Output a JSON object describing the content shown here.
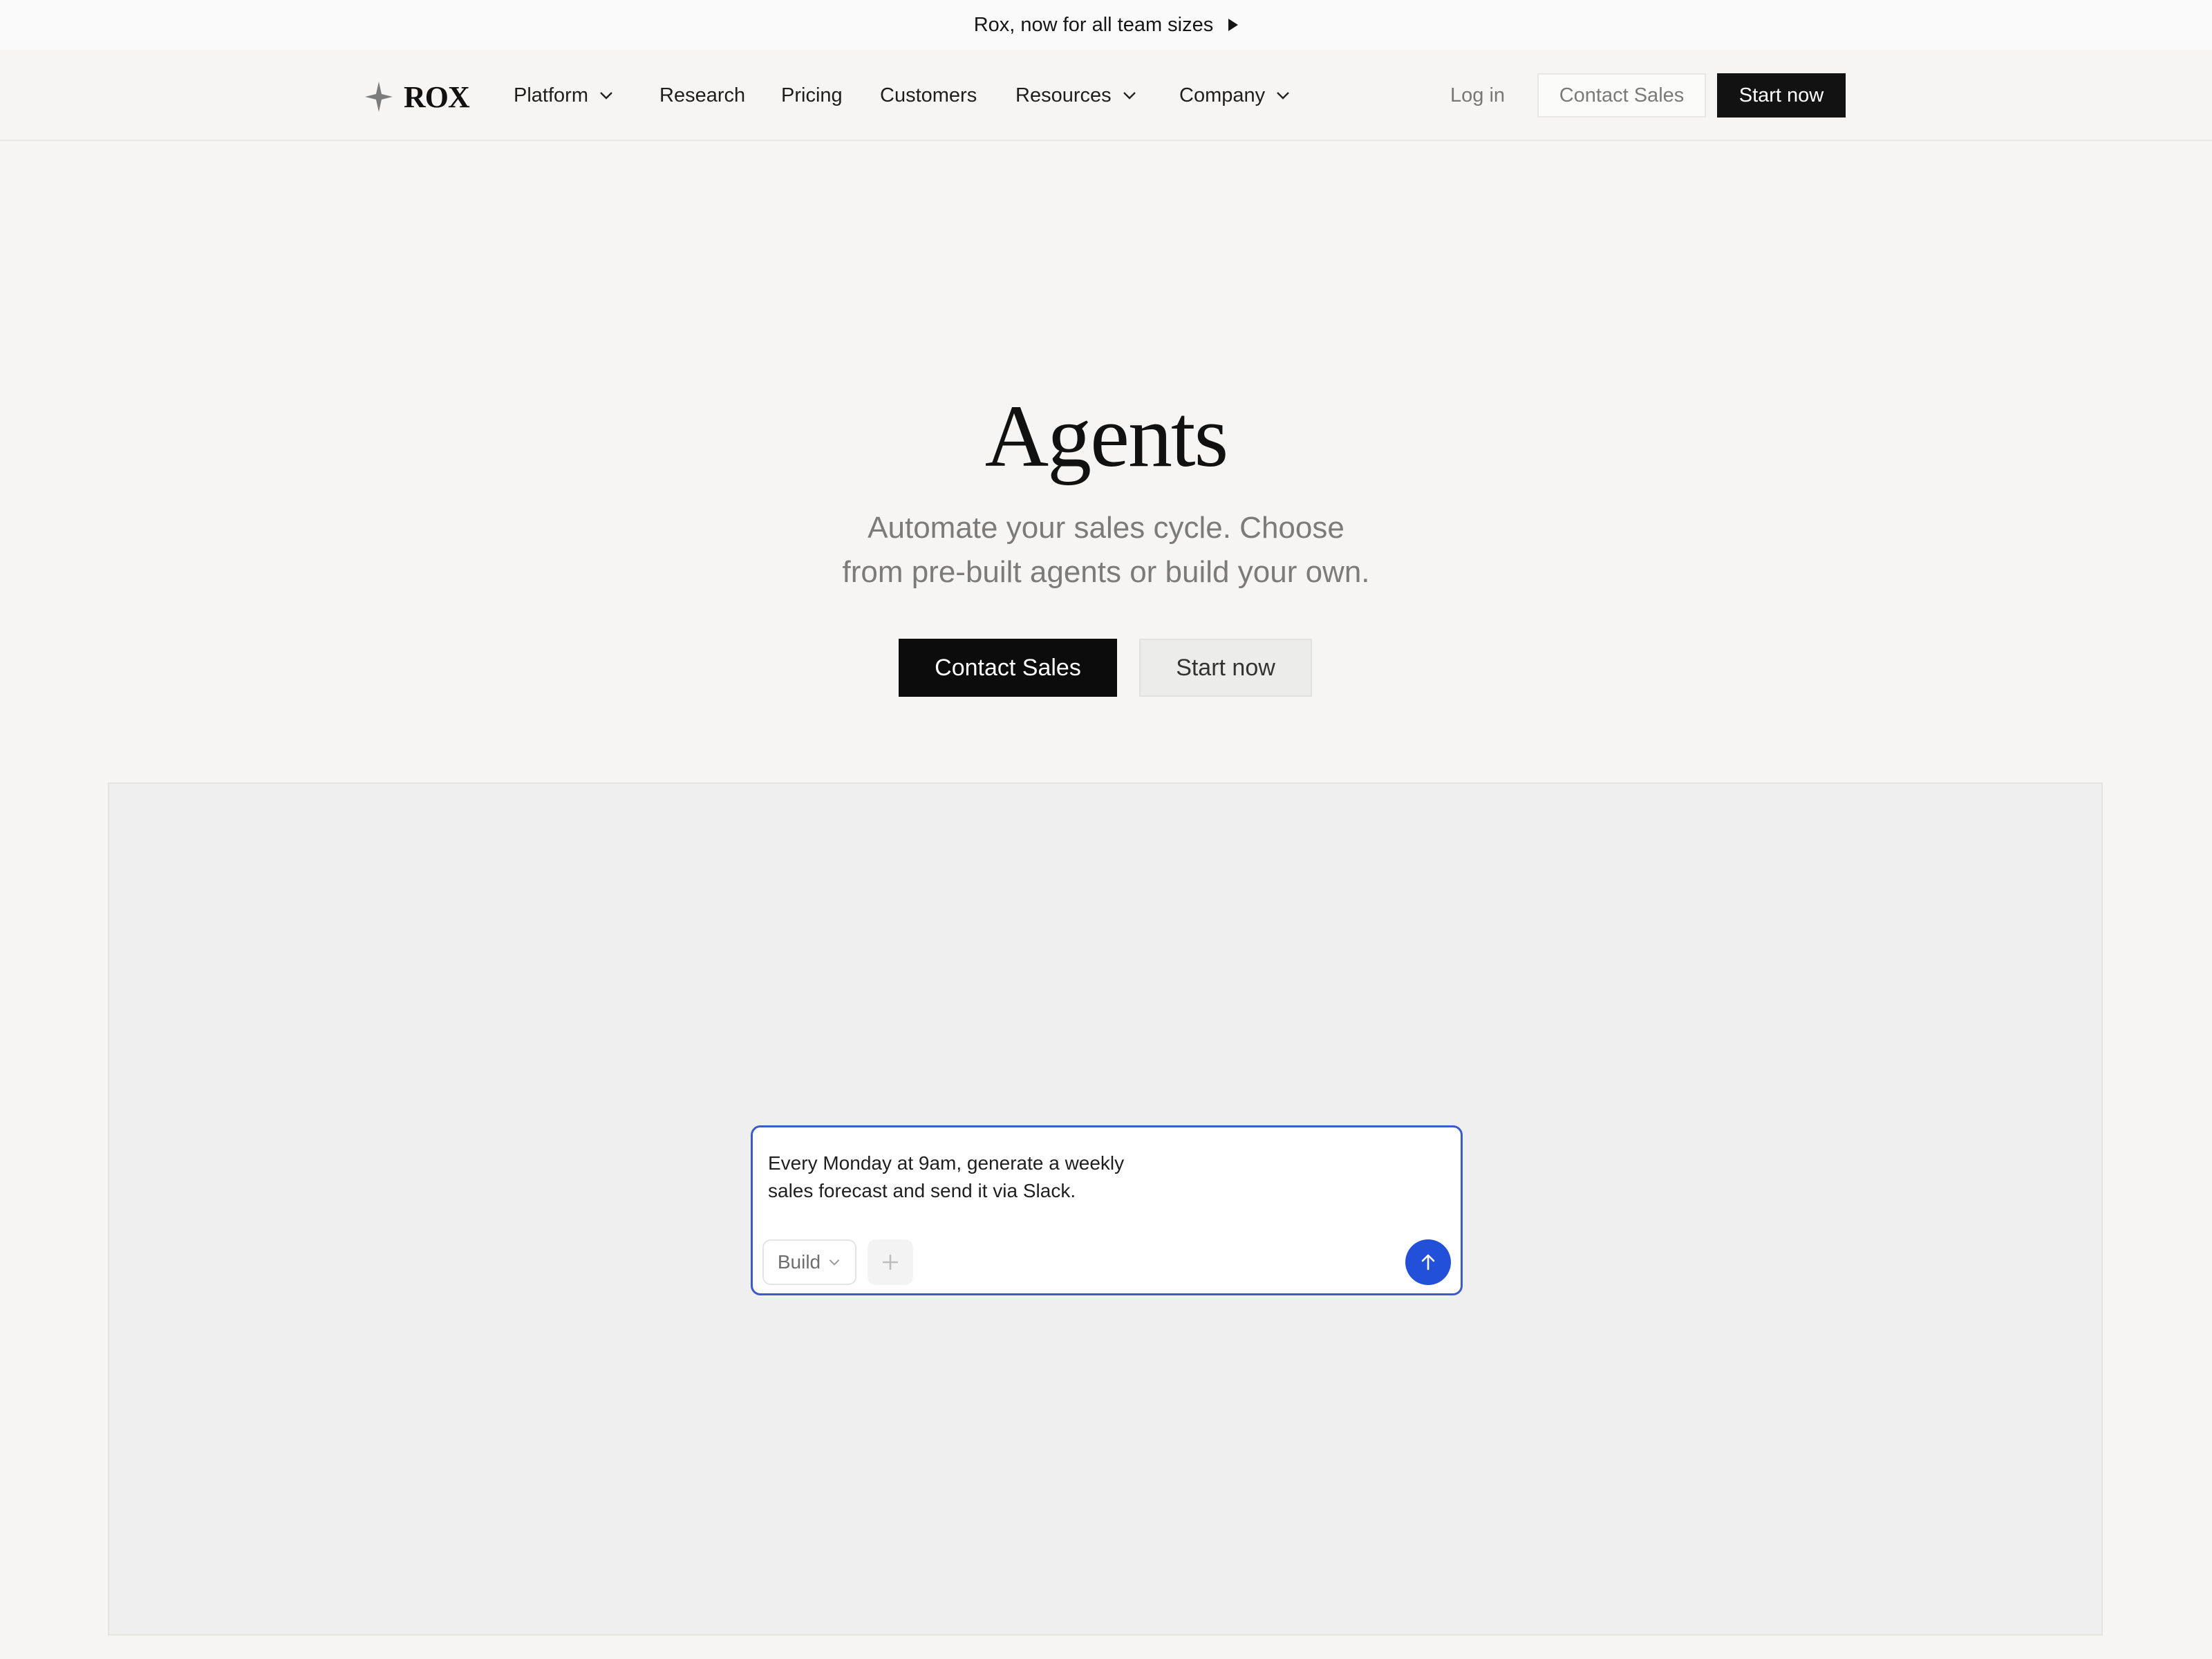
{
  "announcement": {
    "text": "Rox, now for all team sizes",
    "icon": "play-icon"
  },
  "nav": {
    "logo_text": "ROX",
    "logo_icon": "sparkle-icon",
    "items": [
      {
        "label": "Platform",
        "has_dropdown": true
      },
      {
        "label": "Research",
        "has_dropdown": false
      },
      {
        "label": "Pricing",
        "has_dropdown": false
      },
      {
        "label": "Customers",
        "has_dropdown": false
      },
      {
        "label": "Resources",
        "has_dropdown": true
      },
      {
        "label": "Company",
        "has_dropdown": true
      }
    ],
    "login_label": "Log in",
    "contact_label": "Contact Sales",
    "start_label": "Start now"
  },
  "hero": {
    "title": "Agents",
    "subtitle_line1": "Automate your sales cycle. Choose",
    "subtitle_line2": "from pre-built agents or build your own.",
    "primary_cta": "Contact Sales",
    "secondary_cta": "Start now"
  },
  "composer": {
    "text_line1": "Every Monday at 9am, generate a weekly",
    "text_line2": "sales forecast and send it via Slack.",
    "mode_label": "Build",
    "add_icon": "plus-icon",
    "send_icon": "arrow-up-icon"
  },
  "colors": {
    "background": "#f6f5f3",
    "dark_button": "#121212",
    "accent_blue": "#2350d8",
    "composer_border": "#3b5bc9"
  }
}
